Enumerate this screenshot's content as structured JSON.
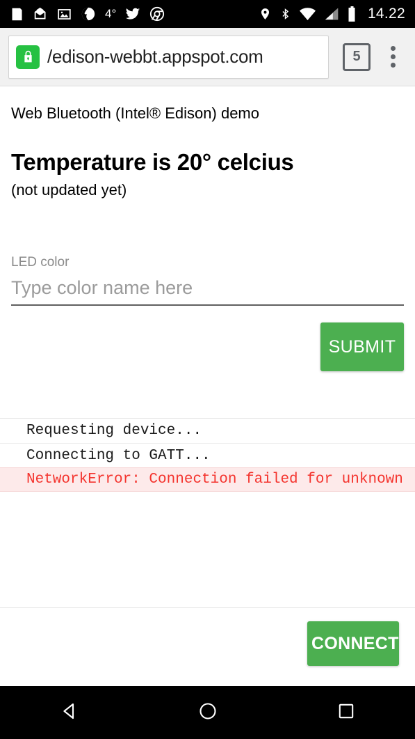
{
  "statusbar": {
    "icons_left": [
      "news-icon",
      "mail-icon",
      "photo-icon",
      "app-icon"
    ],
    "temperature": "4°",
    "icons_left_after": [
      "twitter-icon",
      "chrome-icon"
    ],
    "icons_right": [
      "location-pin-icon",
      "bluetooth-icon",
      "wifi-icon",
      "signal-icon",
      "battery-icon"
    ],
    "clock": "14.22"
  },
  "browser": {
    "security_icon": "lock-icon",
    "url": "/edison-webbt.appspot.com",
    "tab_count": "5",
    "menu_icon": "overflow-menu-icon"
  },
  "page": {
    "subtitle": "Web Bluetooth (Intel® Edison) demo",
    "temperature_heading": "Temperature is 20° celcius",
    "temperature_note": "(not updated yet)",
    "field_label": "LED color",
    "field_value": "",
    "field_placeholder": "Type color name here",
    "submit_label": "SUBMIT",
    "connect_label": "CONNECT"
  },
  "log": {
    "lines": [
      {
        "text": "Requesting device...",
        "type": "info"
      },
      {
        "text": "Connecting to GATT...",
        "type": "info"
      },
      {
        "text": "NetworkError: Connection failed for unknown",
        "type": "error"
      }
    ]
  },
  "navbar": {
    "back": "back-triangle-icon",
    "home": "home-circle-icon",
    "recents": "recents-square-icon"
  },
  "colors": {
    "accent_green": "#4caf50",
    "lock_green": "#26c142",
    "error_red": "#f4342e",
    "error_bg": "#fdeaea",
    "toolbar_bg": "#f1f1f1"
  }
}
